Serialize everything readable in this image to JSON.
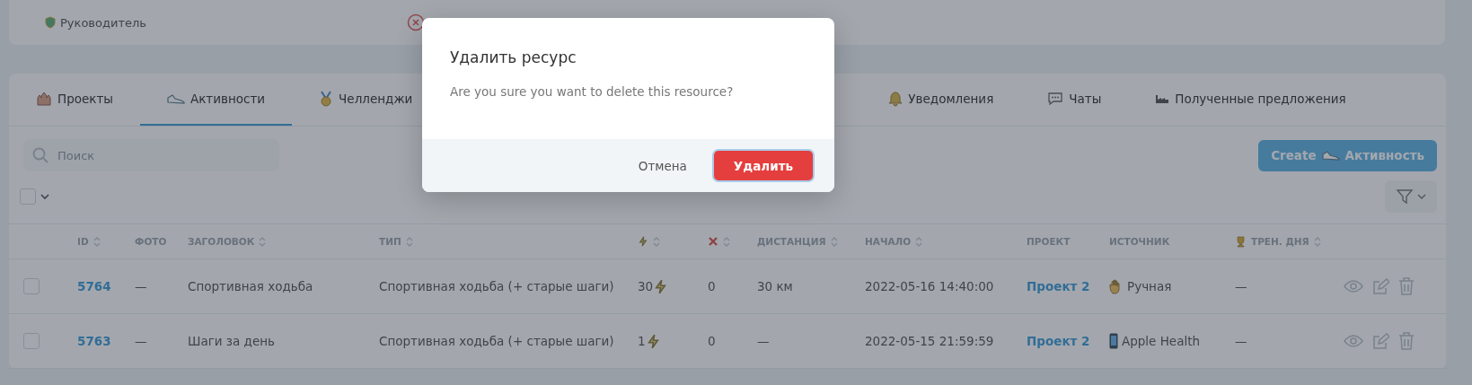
{
  "top_card": {
    "role": "Руководитель"
  },
  "tabs": [
    {
      "label": "Проекты",
      "selected": false
    },
    {
      "label": "Активности",
      "selected": true
    },
    {
      "label": "Челленджи",
      "selected": false
    },
    {
      "label": "Уведомления",
      "selected": false
    },
    {
      "label": "Чаты",
      "selected": false
    },
    {
      "label": "Полученные предложения",
      "selected": false
    }
  ],
  "search": {
    "placeholder": "Поиск"
  },
  "create_button": {
    "label": "Create",
    "label_2": "Активность"
  },
  "select_all": {
    "checked": false
  },
  "table": {
    "columns": [
      {
        "kind": "text",
        "label": "ID",
        "sortable": true
      },
      {
        "kind": "text",
        "label": "ФОТО",
        "sortable": false
      },
      {
        "kind": "text",
        "label": "ЗАГОЛОВОК",
        "sortable": true
      },
      {
        "kind": "text",
        "label": "ТИП",
        "sortable": true
      },
      {
        "kind": "bolt",
        "sortable": true
      },
      {
        "kind": "cross",
        "sortable": true
      },
      {
        "kind": "text",
        "label": "ДИСТАНЦИЯ",
        "sortable": true
      },
      {
        "kind": "text",
        "label": "НАЧАЛО",
        "sortable": true
      },
      {
        "kind": "text",
        "label": "ПРОЕКТ",
        "sortable": false
      },
      {
        "kind": "text",
        "label": "ИСТОЧНИК",
        "sortable": false
      },
      {
        "kind": "trophy",
        "label": "ТРЕН. ДНЯ",
        "sortable": true
      }
    ],
    "rows": [
      {
        "checked": false,
        "id": "5764",
        "photo": "—",
        "title": "Спортивная ходьба",
        "type": "Спортивная ходьба (+ старые шаги)",
        "points": "30",
        "fails": "0",
        "distance": "30 км",
        "start": "2022-05-16 14:40:00",
        "project": "Проект 2",
        "source": "Ручная",
        "kind": "manual",
        "training": "—"
      },
      {
        "checked": false,
        "id": "5763",
        "photo": "—",
        "title": "Шаги за день",
        "type": "Спортивная ходьба (+ старые шаги)",
        "points": "1",
        "fails": "0",
        "distance": "—",
        "start": "2022-05-15 21:59:59",
        "project": "Проект 2",
        "source": "Apple Health",
        "kind": "device",
        "training": "—"
      }
    ]
  },
  "dialog": {
    "title": "Удалить ресурс",
    "message": "Are you sure you want to delete this resource?",
    "cancel": "Отмена",
    "confirm": "Удалить"
  }
}
